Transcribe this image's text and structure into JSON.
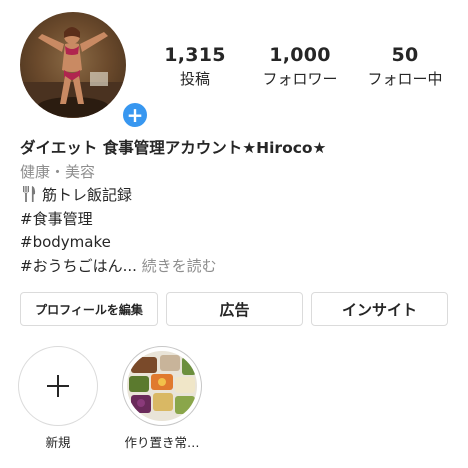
{
  "profile": {
    "display_name": "ダイエット 食事管理アカウント★Hiroco★",
    "category": "健康・美容",
    "add_badge_symbol": "+"
  },
  "stats": {
    "posts_value": "1,315",
    "posts_label": "投稿",
    "followers_value": "1,000",
    "followers_label": "フォロワー",
    "following_value": "50",
    "following_label": "フォロー中"
  },
  "bio": {
    "line1_icon": "fork-knife-icon",
    "line1": "筋トレ飯記録",
    "line2": "#食事管理",
    "line3": "#bodymake",
    "line4": "#おうちごはん...",
    "more": "続きを読む"
  },
  "buttons": {
    "edit_profile": "プロフィールを編集",
    "ad": "広告",
    "insights": "インサイト"
  },
  "highlights": [
    {
      "label": "新規",
      "icon": "plus-icon"
    },
    {
      "label": "作り置き常…",
      "icon": "food-thumbnail"
    }
  ],
  "colors": {
    "accent_blue": "#3897f0",
    "text": "#262626",
    "muted": "#8e8e8e",
    "border": "#dbdbdb"
  }
}
